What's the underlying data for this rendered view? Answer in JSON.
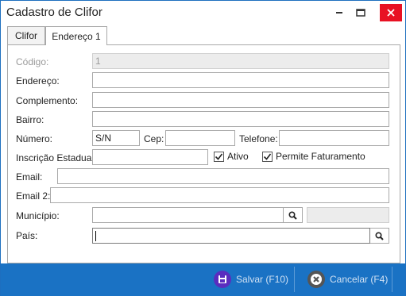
{
  "window": {
    "title": "Cadastro de Clifor",
    "icons": [
      "minimize-icon",
      "maximize-icon",
      "close-icon"
    ],
    "close_color": "#e81123"
  },
  "tabs": [
    {
      "label": "Clifor",
      "active": false
    },
    {
      "label": "Endereço 1",
      "active": true
    }
  ],
  "form": {
    "codigo": {
      "label": "Código:",
      "value": "1"
    },
    "endereco": {
      "label": "Endereço:",
      "value": ""
    },
    "complemento": {
      "label": "Complemento:",
      "value": ""
    },
    "bairro": {
      "label": "Bairro:",
      "value": ""
    },
    "numero": {
      "label": "Número:",
      "value": "S/N"
    },
    "cep": {
      "label": "Cep:",
      "value": ""
    },
    "telefone": {
      "label": "Telefone:",
      "value": ""
    },
    "inscricao": {
      "label": "Inscrição Estadual:",
      "value": ""
    },
    "ativo": {
      "label": "Ativo",
      "checked": true
    },
    "permite": {
      "label": "Permite Faturamento",
      "checked": true
    },
    "email": {
      "label": "Email:",
      "value": ""
    },
    "email2": {
      "label": "Email 2:",
      "value": ""
    },
    "municipio": {
      "label": "Município:",
      "value": "",
      "extra": ""
    },
    "pais": {
      "label": "País:",
      "value": ""
    }
  },
  "footer": {
    "background": "#1a72c4",
    "save": {
      "label": "Salvar (F10)",
      "icon": "floppy-disk-icon",
      "color": "#5a2dbf"
    },
    "cancel": {
      "label": "Cancelar (F4)",
      "icon": "cancel-x-icon",
      "color": "#555555"
    }
  }
}
